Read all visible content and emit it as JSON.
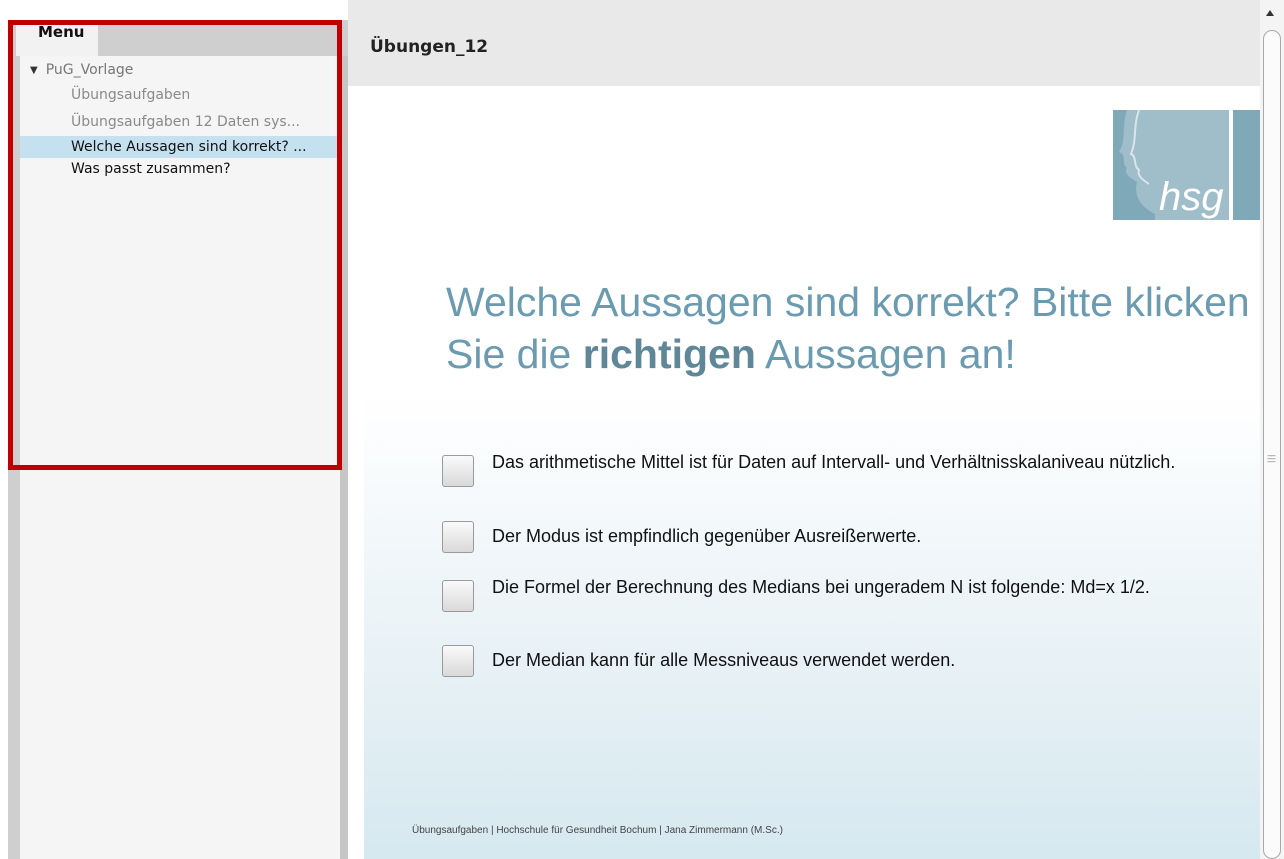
{
  "sidebar": {
    "tab_label": "Menu",
    "root_label": "PuG_Vorlage",
    "items": [
      {
        "label": "Übungsaufgaben",
        "state": "visited"
      },
      {
        "label": "Übungsaufgaben   12 Daten sys...",
        "state": "visited"
      },
      {
        "label": "Welche Aussagen sind korrekt? ...",
        "state": "selected"
      },
      {
        "label": "Was passt zusammen?",
        "state": "normal"
      }
    ]
  },
  "main": {
    "title": "Übungen_12",
    "logo_text": "hsg",
    "question_part1": "Welche Aussagen sind korrekt? Bitte klicken Sie die ",
    "question_bold": "richtigen",
    "question_part2": " Aussagen an!",
    "options": [
      {
        "label": "Das arithmetische Mittel ist für Daten auf Intervall- und Verhältnisskalaniveau nützlich.",
        "checked": false
      },
      {
        "label": "Der Modus ist empfindlich gegenüber Ausreißerwerte.",
        "checked": false
      },
      {
        "label": "Die Formel der Berechnung des Medians bei ungeradem N ist folgende: Md=x 1/2.",
        "checked": false
      },
      {
        "label": "Der Median kann für alle Messniveaus verwendet werden.",
        "checked": false
      }
    ],
    "footer": "Übungsaufgaben | Hochschule für Gesundheit Bochum | Jana Zimmermann (M.Sc.)"
  },
  "colors": {
    "highlight_border": "#c00000",
    "selected_item": "#c5e1f0",
    "question_text": "#6a9bb0",
    "logo": "#7fa8b9"
  }
}
